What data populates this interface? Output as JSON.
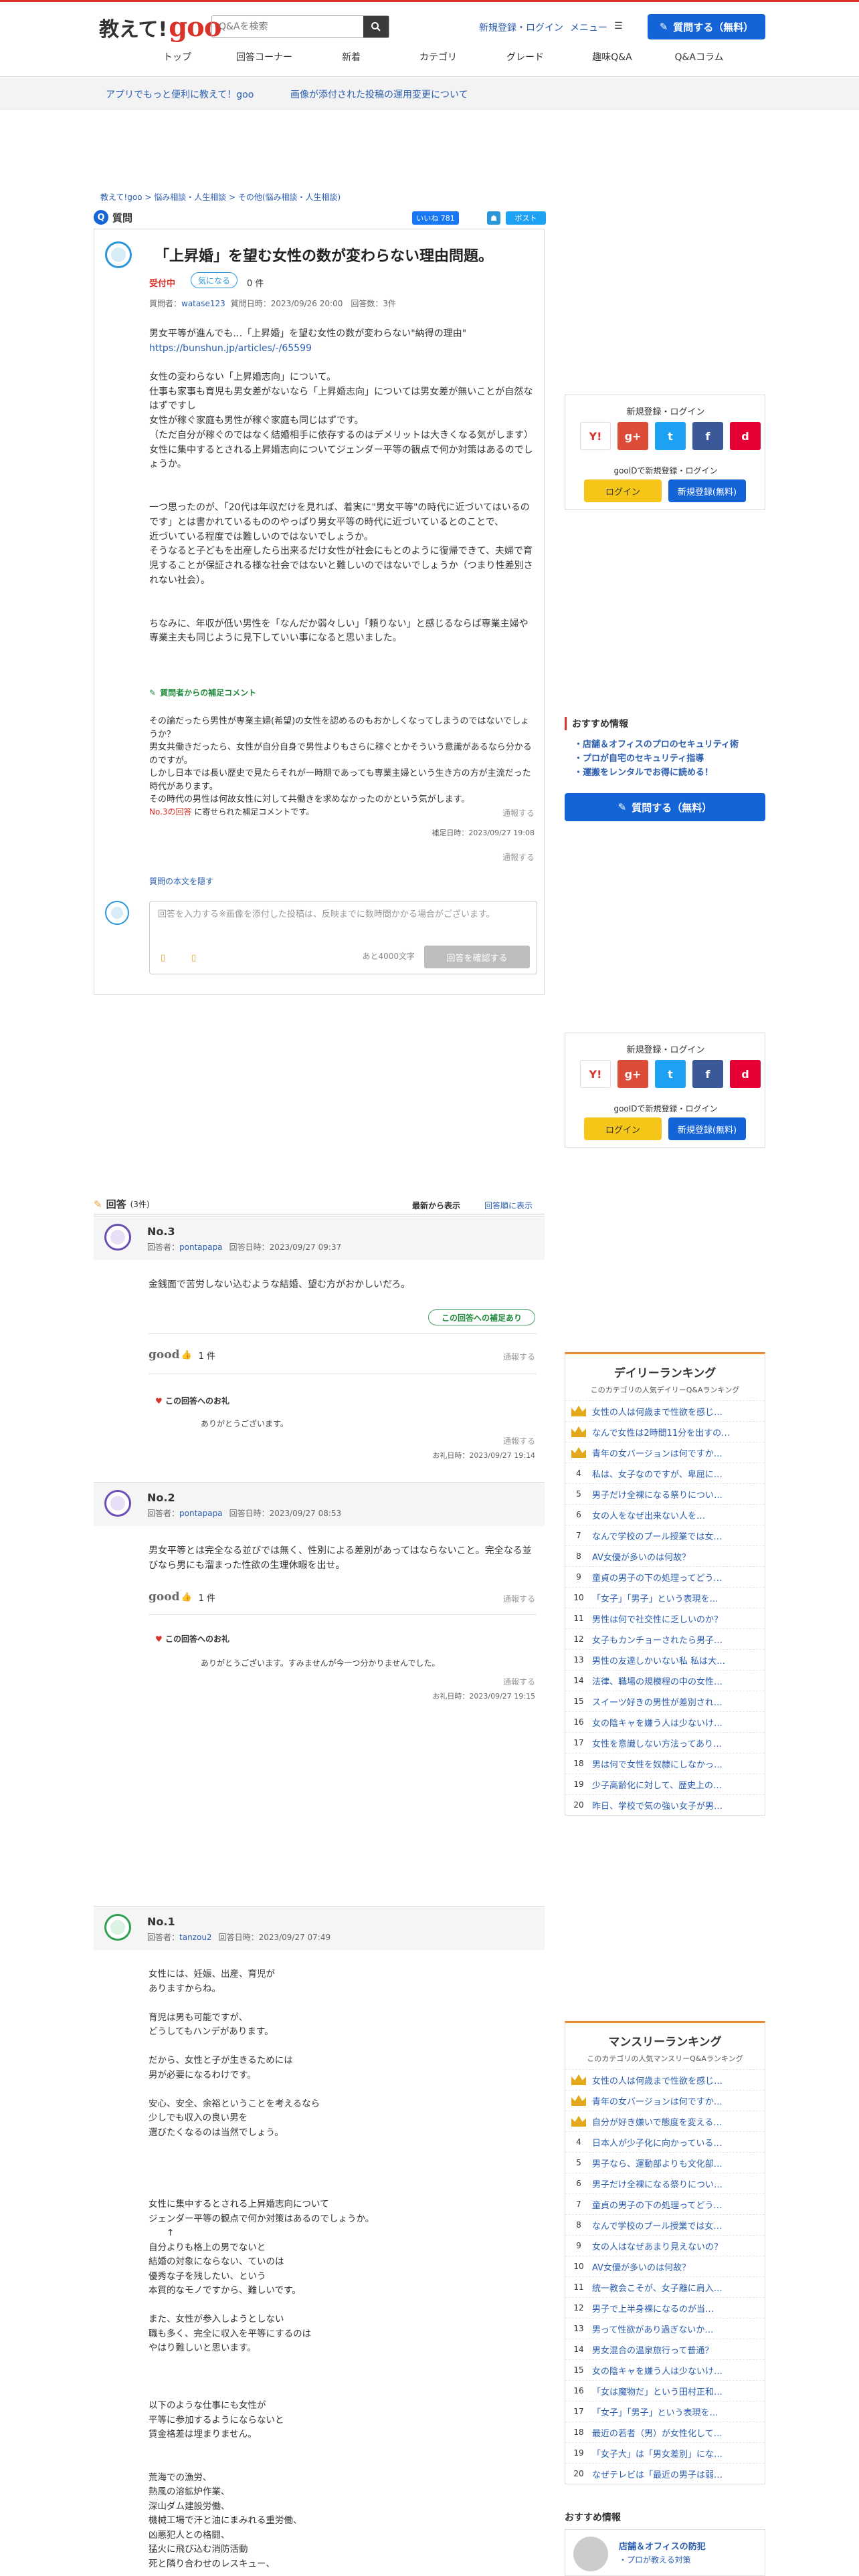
{
  "header": {
    "logo_prefix": "教えて!",
    "logo_brand": "goo",
    "search_placeholder": "Q&Aを検索",
    "login_link": "新規登録・ログイン",
    "menu_link": "メニュー",
    "ask_button": "質問する（無料）",
    "nav": [
      "トップ",
      "回答コーナー",
      "新着",
      "カテゴリ",
      "グレード",
      "趣味Q&A",
      "Q&Aコラム"
    ]
  },
  "subnav": {
    "app_link": "アプリでもっと便利に教えて！goo",
    "notice_link": "画像が添付された投稿の運用変更について"
  },
  "breadcrumb": "教えて!goo > 悩み相談・人生相談 > その他(悩み相談・人生相談)",
  "question": {
    "section_label": "質問",
    "like_label": "いいね 781",
    "tweet_label": "ポスト",
    "title": "「上昇婚」を望む女性の数が変わらない理由問題。",
    "status": "受付中",
    "follow_label": "気になる",
    "follow_count": "0 件",
    "meta_prefix": "質問者：",
    "asker": "watase123",
    "meta_rest": "質問日時：2023/09/26 20:00　回答数：3件",
    "body_p1": "男女平等が進んでも…「上昇婚」を望む女性の数が変わらない\"納得の理由\"",
    "body_url": "https://bunshun.jp/articles/-/65599",
    "body_p2": "女性の変わらない「上昇婚志向」について。\n仕事も家事も育児も男女差がないなら「上昇婚志向」については男女差が無いことが自然なはずですし\n女性が稼ぐ家庭も男性が稼ぐ家庭も同じはずです。\n（ただ自分が稼ぐのではなく結婚相手に依存するのはデメリットは大きくなる気がします）\n女性に集中するとされる上昇婚志向についてジェンダー平等の観点で何か対策はあるのでしょうか。\n\n\n一つ思ったのが、「20代は年収だけを見れば、着実に\"男女平等\"の時代に近づいてはいるのです」とは書かれているもののやっぱり男女平等の時代に近づいているとのことで、\n近づいている程度では難しいのではないでしょうか。\nそうなると子どもを出産したら出来るだけ女性が社会にもとのように復帰できて、夫婦で育児することが保証される様な社会ではないと難しいのではないでしょうか（つまり性差別されない社会）。\n\n\nちなみに、年収が低い男性を「なんだか弱々しい」「頼りない」と感じるならば専業主婦や専業主夫も同じように見下していい事になると思いました。",
    "supp_label": "質問者からの補足コメント",
    "supp_body": "その論だったら男性が専業主婦(希望)の女性を認めるのもおかしくなってしまうのではないでしょうか？\n男女共働きだったら、女性が自分自身で男性よりもさらに稼ぐとかそういう意識があるなら分かるのですが。\nしかし日本では長い歴史で見たらそれが一時期であっても専業主婦という生き方の方が主流だった時代があります。\nその時代の男性は何故女性に対して共働きを求めなかったのかという気がします。",
    "supp_ref_a": "No.3の回答",
    "supp_ref_b": " に寄せられた補足コメントです。",
    "report": "通報する",
    "supp_date": "補足日時：2023/09/27 19:08",
    "hide_link": "質問の本文を隠す",
    "answer_placeholder": "回答を入力する※画像を添付した投稿は、反映までに数時間かかる場合がございます。",
    "answer_chars": "あと4000文字",
    "answer_button": "回答を確認する"
  },
  "sidebar": {
    "login_title": "新規登録・ログイン",
    "social": [
      "Y!",
      "g+",
      "t",
      "f",
      "d"
    ],
    "gooid_text": "gooIDで新規登録・ログイン",
    "login_btn": "ログイン",
    "register_btn": "新規登録(無料)",
    "rec_title": "おすすめ情報",
    "rec_items": [
      "・店舗＆オフィスのプロのセキュリティ術",
      "・プロが自宅のセキュリティ指導",
      "・運搬をレンタルでお得に読める！"
    ],
    "ask_button": "質問する（無料）"
  },
  "daily_ranking": {
    "title": "デイリーランキング",
    "subtitle": "このカテゴリの人気デイリーQ&Aランキング",
    "items": [
      "女性の人は何歳まで性欲を感じ…",
      "なんで女性は2時間11分を出すの…",
      "青年の女バージョンは何ですか…",
      "私は、女子なのですが、卑屈に…",
      "男子だけ全裸になる祭りについ…",
      "女の人をなぜ出来ない人を…",
      "なんで学校のプール授業では女…",
      "AV女優が多いのは何故？",
      "童貞の男子の下の処理ってどう…",
      "「女子」「男子」という表現を…",
      "男性は何で社交性に乏しいのか？",
      "女子もカンチョーされたら男子…",
      "男性の友達しかいない私 私は大…",
      "法律、職場の規模程の中の女性…",
      "スイーツ好きの男性が差別され…",
      "女の陰キャを嫌う人は少ないけ…",
      "女性を意識しない方法ってあり…",
      "男は何で女性を奴隷にしなかっ…",
      "少子高齢化に対して、歴史上の…",
      "昨日、学校で気の強い女子が男…"
    ]
  },
  "monthly_ranking": {
    "title": "マンスリーランキング",
    "subtitle": "このカテゴリの人気マンスリーQ&Aランキング",
    "items": [
      "女性の人は何歳まで性欲を感じ…",
      "青年の女バージョンは何ですか…",
      "自分が好き嫌いで態度を変える…",
      "日本人が少子化に向かっている…",
      "男子なら、運動部よりも文化部…",
      "男子だけ全裸になる祭りについ…",
      "童貞の男子の下の処理ってどう…",
      "なんで学校のプール授業では女…",
      "女の人はなぜあまり見えないの？",
      "AV女優が多いのは何故？",
      "統一教会こそが、女子離に肩入…",
      "男子で上半身裸になるのが当…",
      "男って性欲があり過ぎないか…",
      "男女混合の温泉旅行って普通？",
      "女の陰キャを嫌う人は少ないけ…",
      "「女は魔物だ」という田村正和…",
      "「女子」「男子」という表現を…",
      "最近の若者（男）が女性化して…",
      "「女子大」は「男女差別」にな…",
      "なぜテレビは「最近の男子は弱…"
    ]
  },
  "answers_section": {
    "label": "回答",
    "count": "(3件)",
    "sort_label": "最新から表示",
    "order_link": "回答順に表示"
  },
  "answers": [
    {
      "no": "No.3",
      "meta_prefix": "回答者：",
      "user": "pontapapa",
      "date": "回答日時：2023/09/27 09:37",
      "body": "金銭面で苦労しない込むような結婚、望む方がおかしいだろ。",
      "supp_btn": "この回答への補足あり",
      "good_label": "good",
      "good_count": "1 件",
      "report": "通報する",
      "thanks_label": "この回答へのお礼",
      "thanks_text": "ありがとうございます。",
      "thanks_date": "お礼日時：2023/09/27 19:14"
    },
    {
      "no": "No.2",
      "meta_prefix": "回答者：",
      "user": "pontapapa",
      "date": "回答日時：2023/09/27 08:53",
      "body": "男女平等とは完全なる並びでは無く、性別による差別があってはならないこと。完全なる並びなら男にも溜まった性欲の生理休暇を出せ。",
      "good_label": "good",
      "good_count": "1 件",
      "report": "通報する",
      "thanks_label": "この回答へのお礼",
      "thanks_text": "ありがとうございます。すみませんが今一つ分かりませんでした。",
      "thanks_date": "お礼日時：2023/09/27 19:15"
    },
    {
      "no": "No.1",
      "meta_prefix": "回答者：",
      "user": "tanzou2",
      "date": "回答日時：2023/09/27 07:49",
      "body": "女性には、妊娠、出産、育児が\nありますからね。\n\n育児は男も可能ですが、\nどうしてもハンデがあります。\n\nだから、女性と子が生きるためには\n男が必要になるわけです。\n\n安心、安全、余裕ということを考えるなら\n少しでも収入の良い男を\n選びたくなるのは当然でしょう。\n\n\n\n\n女性に集中するとされる上昇婚志向について\nジェンダー平等の観点で何か対策はあるのでしょうか。\n　　↑\n自分よりも格上の男でないと\n結婚の対象にならない、ていのは\n優秀な子を残したい、という\n本質的なモノですから、難しいです。\n\nまた、女性が参入しようとしない\n職も多く、完全に収入を平等にするのは\nやはり難しいと思います。\n\n\n\n以下のような仕事にも女性が\n平等に参加するようにならないと\n賃金格差は埋まりません。\n\n\n荒海での漁労、\n熱風の溶鉱炉作業、\n深山ダム建設労働、\n機械工場で汗と油にまみれる重労働、\n凶悪犯人との格闘、\n猛火に飛び込む消防活動\n死と隣り合わせのレスキュー、"
    }
  ],
  "other_info": {
    "title": "おすすめ情報",
    "item": "店舗＆オフィスの防犯",
    "sub": "・プロが教える対策"
  }
}
